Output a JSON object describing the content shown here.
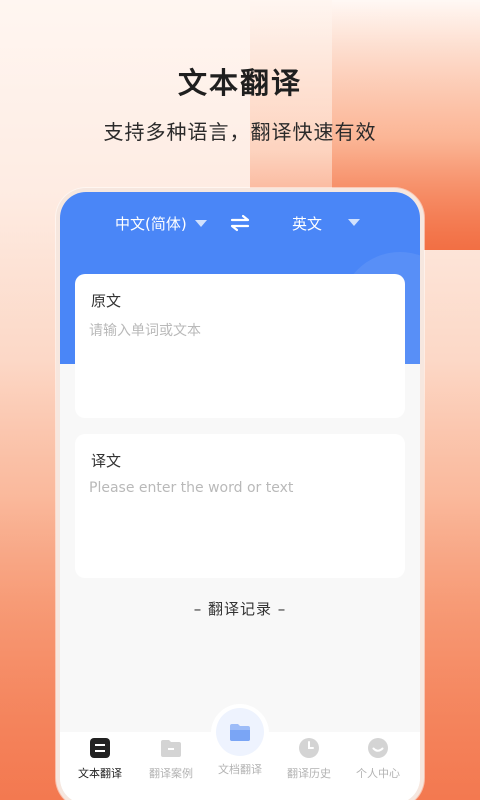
{
  "promo": {
    "title": "文本翻译",
    "subtitle": "支持多种语言，翻译快速有效"
  },
  "languages": {
    "source": "中文(简体)",
    "target": "英文",
    "swap_icon": "swap-arrows-icon",
    "caret_icon": "caret-down-icon"
  },
  "source_card": {
    "title": "原文",
    "placeholder": "请输入单词或文本"
  },
  "target_card": {
    "title": "译文",
    "placeholder": "Please enter the word or text"
  },
  "history": {
    "label": "– 翻译记录 –"
  },
  "tabs": [
    {
      "label": "文本翻译",
      "icon": "text-translate-icon",
      "active": true
    },
    {
      "label": "翻译案例",
      "icon": "folder-icon",
      "active": false
    },
    {
      "label": "文档翻译",
      "icon": "document-folder-icon",
      "active": false
    },
    {
      "label": "翻译历史",
      "icon": "clock-icon",
      "active": false
    },
    {
      "label": "个人中心",
      "icon": "smiley-icon",
      "active": false
    }
  ],
  "colors": {
    "accent": "#4a86f7",
    "background_warm": "#f37b50"
  }
}
